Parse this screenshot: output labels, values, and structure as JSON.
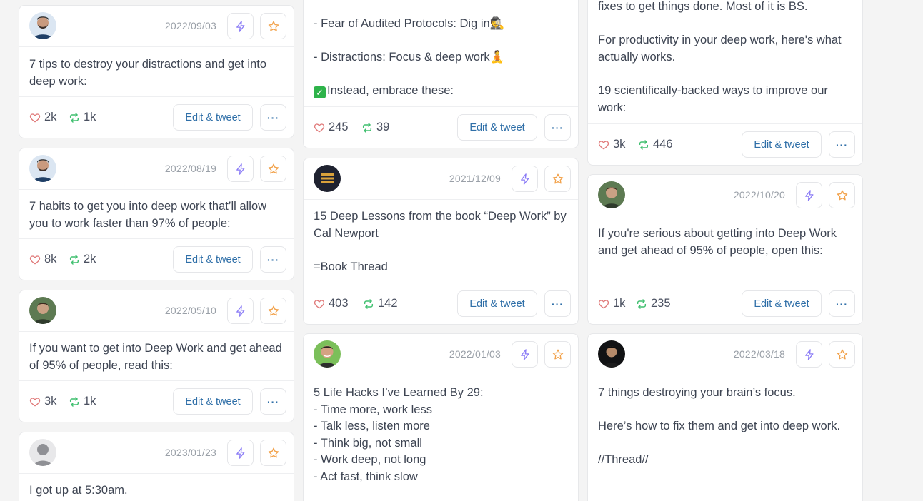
{
  "colors": {
    "accent_link": "#2f6fa8",
    "heart": "#e07a7a",
    "retweet": "#3fbf6f",
    "bolt": "#8b7cf6",
    "star": "#f2a24b"
  },
  "actions": {
    "edit_label": "Edit & tweet",
    "more_label": "···"
  },
  "col1": [
    {
      "date": "2022/09/03",
      "text": "7 tips to destroy your distractions and get into deep work:",
      "likes": "2k",
      "retweets": "1k",
      "avatar": "bearded-man"
    },
    {
      "date": "2022/08/19",
      "text": "7 habits to get you into deep work that’ll allow you to work faster than 97% of people:",
      "likes": "8k",
      "retweets": "2k",
      "avatar": "bearded-man"
    },
    {
      "date": "2022/05/10",
      "text": "If you want to get into Deep Work and get ahead of 95% of people, read this:",
      "likes": "3k",
      "retweets": "1k",
      "avatar": "outdoor-man"
    },
    {
      "date": "2023/01/23",
      "text": "I got up at 5:30am.",
      "avatar": "default-user"
    }
  ],
  "col2": [
    {
      "text_lines": [
        "- Fear of Audited Protocols: Dig in🕵",
        "",
        "- Distractions: Focus & deep work🧘",
        ""
      ],
      "check_line": "Instead, embrace these:",
      "likes": "245",
      "retweets": "39"
    },
    {
      "date": "2021/12/09",
      "text": "15 Deep Lessons from the book “Deep Work” by Cal Newport\n\n=Book Thread",
      "likes": "403",
      "retweets": "142",
      "avatar": "book-logo"
    },
    {
      "date": "2022/01/03",
      "text": "5 Life Hacks I’ve Learned By 29:\n- Time more, work less\n- Talk less, listen more\n- Think big, not small\n- Work deep, not long\n- Act fast, think slow",
      "avatar": "smiling-man"
    }
  ],
  "col3": [
    {
      "text": "fixes to get things done. Most of it is BS.\n\nFor productivity in your deep work, here's what actually works.\n\n19 scientifically-backed ways to improve our work:",
      "likes": "3k",
      "retweets": "446"
    },
    {
      "date": "2022/10/20",
      "text": "If you're serious about getting into Deep Work and get ahead of 95% of people, open this:",
      "likes": "1k",
      "retweets": "235",
      "avatar": "outdoor-man"
    },
    {
      "date": "2022/03/18",
      "text": "7 things destroying your brain’s focus.\n\nHere’s how to fix them and get into deep work.\n\n//Thread//",
      "avatar": "dark-man"
    }
  ]
}
